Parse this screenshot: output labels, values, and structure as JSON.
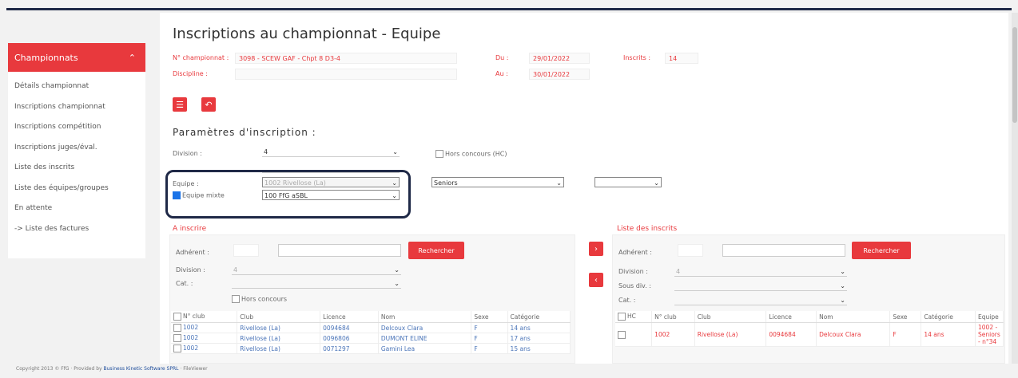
{
  "sidebar": {
    "header": "Championnats",
    "items": [
      {
        "label": "Détails championnat"
      },
      {
        "label": "Inscriptions championnat"
      },
      {
        "label": "Inscriptions compétition"
      },
      {
        "label": "Inscriptions juges/éval."
      },
      {
        "label": "Liste des inscrits"
      },
      {
        "label": "Liste des équipes/groupes"
      },
      {
        "label": "En attente"
      },
      {
        "label": "-> Liste des factures"
      }
    ]
  },
  "page": {
    "title": "Inscriptions au championnat - Equipe",
    "championnat_label": "N° championnat :",
    "championnat_value": "3098 - SCEW GAF - Chpt 8 D3-4",
    "discipline_label": "Discipline :",
    "du_label": "Du :",
    "du_value": "29/01/2022",
    "au_label": "Au :",
    "au_value": "30/01/2022",
    "inscrits_label": "Inscrits :",
    "inscrits_value": "14"
  },
  "params": {
    "section_title": "Paramètres d'inscription :",
    "division_label": "Division :",
    "division_value": "4",
    "hors_concours_label": "Hors concours (HC)",
    "equipe_label": "Equipe :",
    "equipe_value": "1002 Rivellose (La)",
    "equipe_mixte_label": "Equipe mixte",
    "club_select_value": "100 FfG aSBL",
    "categorie_value": "Seniors",
    "extra_select_value": ""
  },
  "a_inscrire": {
    "title": "A inscrire",
    "adherent_label": "Adhérent :",
    "search_button": "Rechercher",
    "division_label": "Division :",
    "division_value": "4",
    "cat_label": "Cat. :",
    "hors_concours_label": "Hors concours",
    "columns": [
      "N° club",
      "Club",
      "Licence",
      "Nom",
      "Sexe",
      "Catégorie"
    ],
    "rows": [
      [
        "1002",
        "Rivellose (La)",
        "0094684",
        "Delcoux Clara",
        "F",
        "14 ans"
      ],
      [
        "1002",
        "Rivellose (La)",
        "0096806",
        "DUMONT ELINE",
        "F",
        "17 ans"
      ],
      [
        "1002",
        "Rivellose (La)",
        "0071297",
        "Gamini Lea",
        "F",
        "15 ans"
      ]
    ]
  },
  "inscrits": {
    "title": "Liste des inscrits",
    "adherent_label": "Adhérent :",
    "search_button": "Rechercher",
    "division_label": "Division :",
    "division_value": "4",
    "sous_div_label": "Sous div. :",
    "cat_label": "Cat. :",
    "columns": [
      "HC",
      "N° club",
      "Club",
      "Licence",
      "Nom",
      "Sexe",
      "Catégorie",
      "Equipe"
    ],
    "rows": [
      [
        "",
        "1002",
        "Rivellose (La)",
        "0094684",
        "Delcoux Clara",
        "F",
        "14 ans",
        "1002 - Seniors - n°34"
      ]
    ]
  },
  "footer": {
    "copyright": "Copyright 2013 © FfG · Provided by",
    "link": "Business Kinetic Software SPRL",
    "suffix": "· FileViewer"
  }
}
